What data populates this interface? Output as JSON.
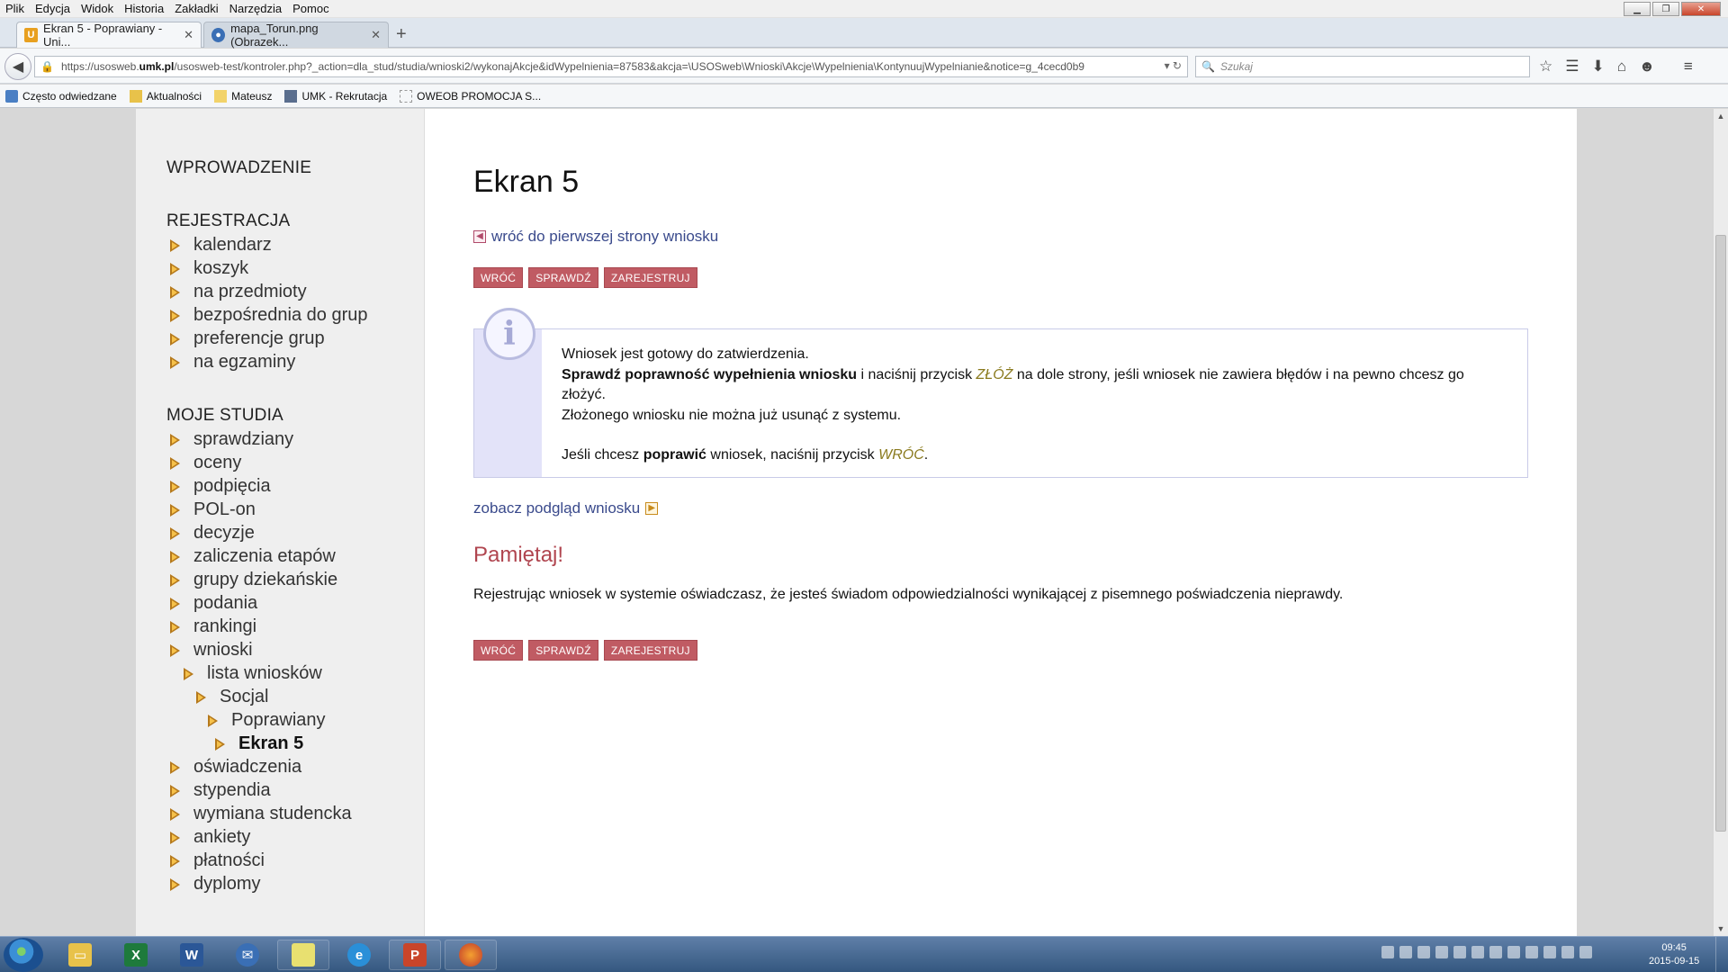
{
  "browser": {
    "menu": [
      "Plik",
      "Edycja",
      "Widok",
      "Historia",
      "Zakładki",
      "Narzędzia",
      "Pomoc"
    ],
    "tabs": [
      {
        "title": "Ekran 5 - Poprawiany - Uni...",
        "active": true
      },
      {
        "title": "mapa_Torun.png (Obrazek...",
        "active": false
      }
    ],
    "url_prefix": "https://usosweb.",
    "url_domain": "umk.pl",
    "url_rest": "/usosweb-test/kontroler.php?_action=dla_stud/studia/wnioski2/wykonajAkcje&idWypelnienia=87583&akcja=\\USOSweb\\Wnioski\\Akcje\\Wypelnienia\\KontynuujWypelnianie&notice=g_4cecd0b9",
    "search_placeholder": "Szukaj",
    "bookmarks": [
      "Często odwiedzane",
      "Aktualności",
      "Mateusz",
      "UMK - Rekrutacja",
      "OWEOB PROMOCJA S..."
    ]
  },
  "sidebar": {
    "sections": [
      {
        "title": "WPROWADZENIE",
        "items": []
      },
      {
        "title": "REJESTRACJA",
        "items": [
          "kalendarz",
          "koszyk",
          "na przedmioty",
          "bezpośrednia do grup",
          "preferencje grup",
          "na egzaminy"
        ]
      },
      {
        "title": "MOJE STUDIA",
        "items": [
          "sprawdziany",
          "oceny",
          "podpięcia",
          "POL-on",
          "decyzje",
          "zaliczenia etapów",
          "grupy dziekańskie",
          "podania",
          "rankingi",
          "wnioski",
          "lista wniosków",
          "Socjal",
          "Poprawiany",
          "Ekran 5",
          "oświadczenia",
          "stypendia",
          "wymiana studencka",
          "ankiety",
          "płatności",
          "dyplomy"
        ]
      }
    ]
  },
  "main": {
    "title": "Ekran 5",
    "back_link": "wróć do pierwszej strony wniosku",
    "buttons": [
      "WRÓĆ",
      "SPRAWDŹ",
      "ZAREJESTRUJ"
    ],
    "info": {
      "line1": "Wniosek jest gotowy do zatwierdzenia.",
      "line2_bold": "Sprawdź poprawność wypełnienia wniosku",
      "line2_a": " i naciśnij przycisk ",
      "line2_kw": "ZŁÓŻ",
      "line2_b": " na dole strony, jeśli wniosek nie zawiera błędów i na pewno chcesz go złożyć.",
      "line3": "Złożonego wniosku nie można już usunąć z systemu.",
      "line4_a": "Jeśli chcesz ",
      "line4_bold": "poprawić",
      "line4_b": " wniosek, naciśnij przycisk ",
      "line4_kw": "WRÓĆ",
      "line4_end": "."
    },
    "preview_link": "zobacz podgląd wniosku",
    "remember_title": "Pamiętaj!",
    "declaration": "Rejestrując wniosek w systemie oświadczasz, że jesteś świadom odpowiedzialności wynikającej z pisemnego poświadczenia nieprawdy."
  },
  "taskbar": {
    "time": "09:45",
    "date": "2015-09-15"
  }
}
